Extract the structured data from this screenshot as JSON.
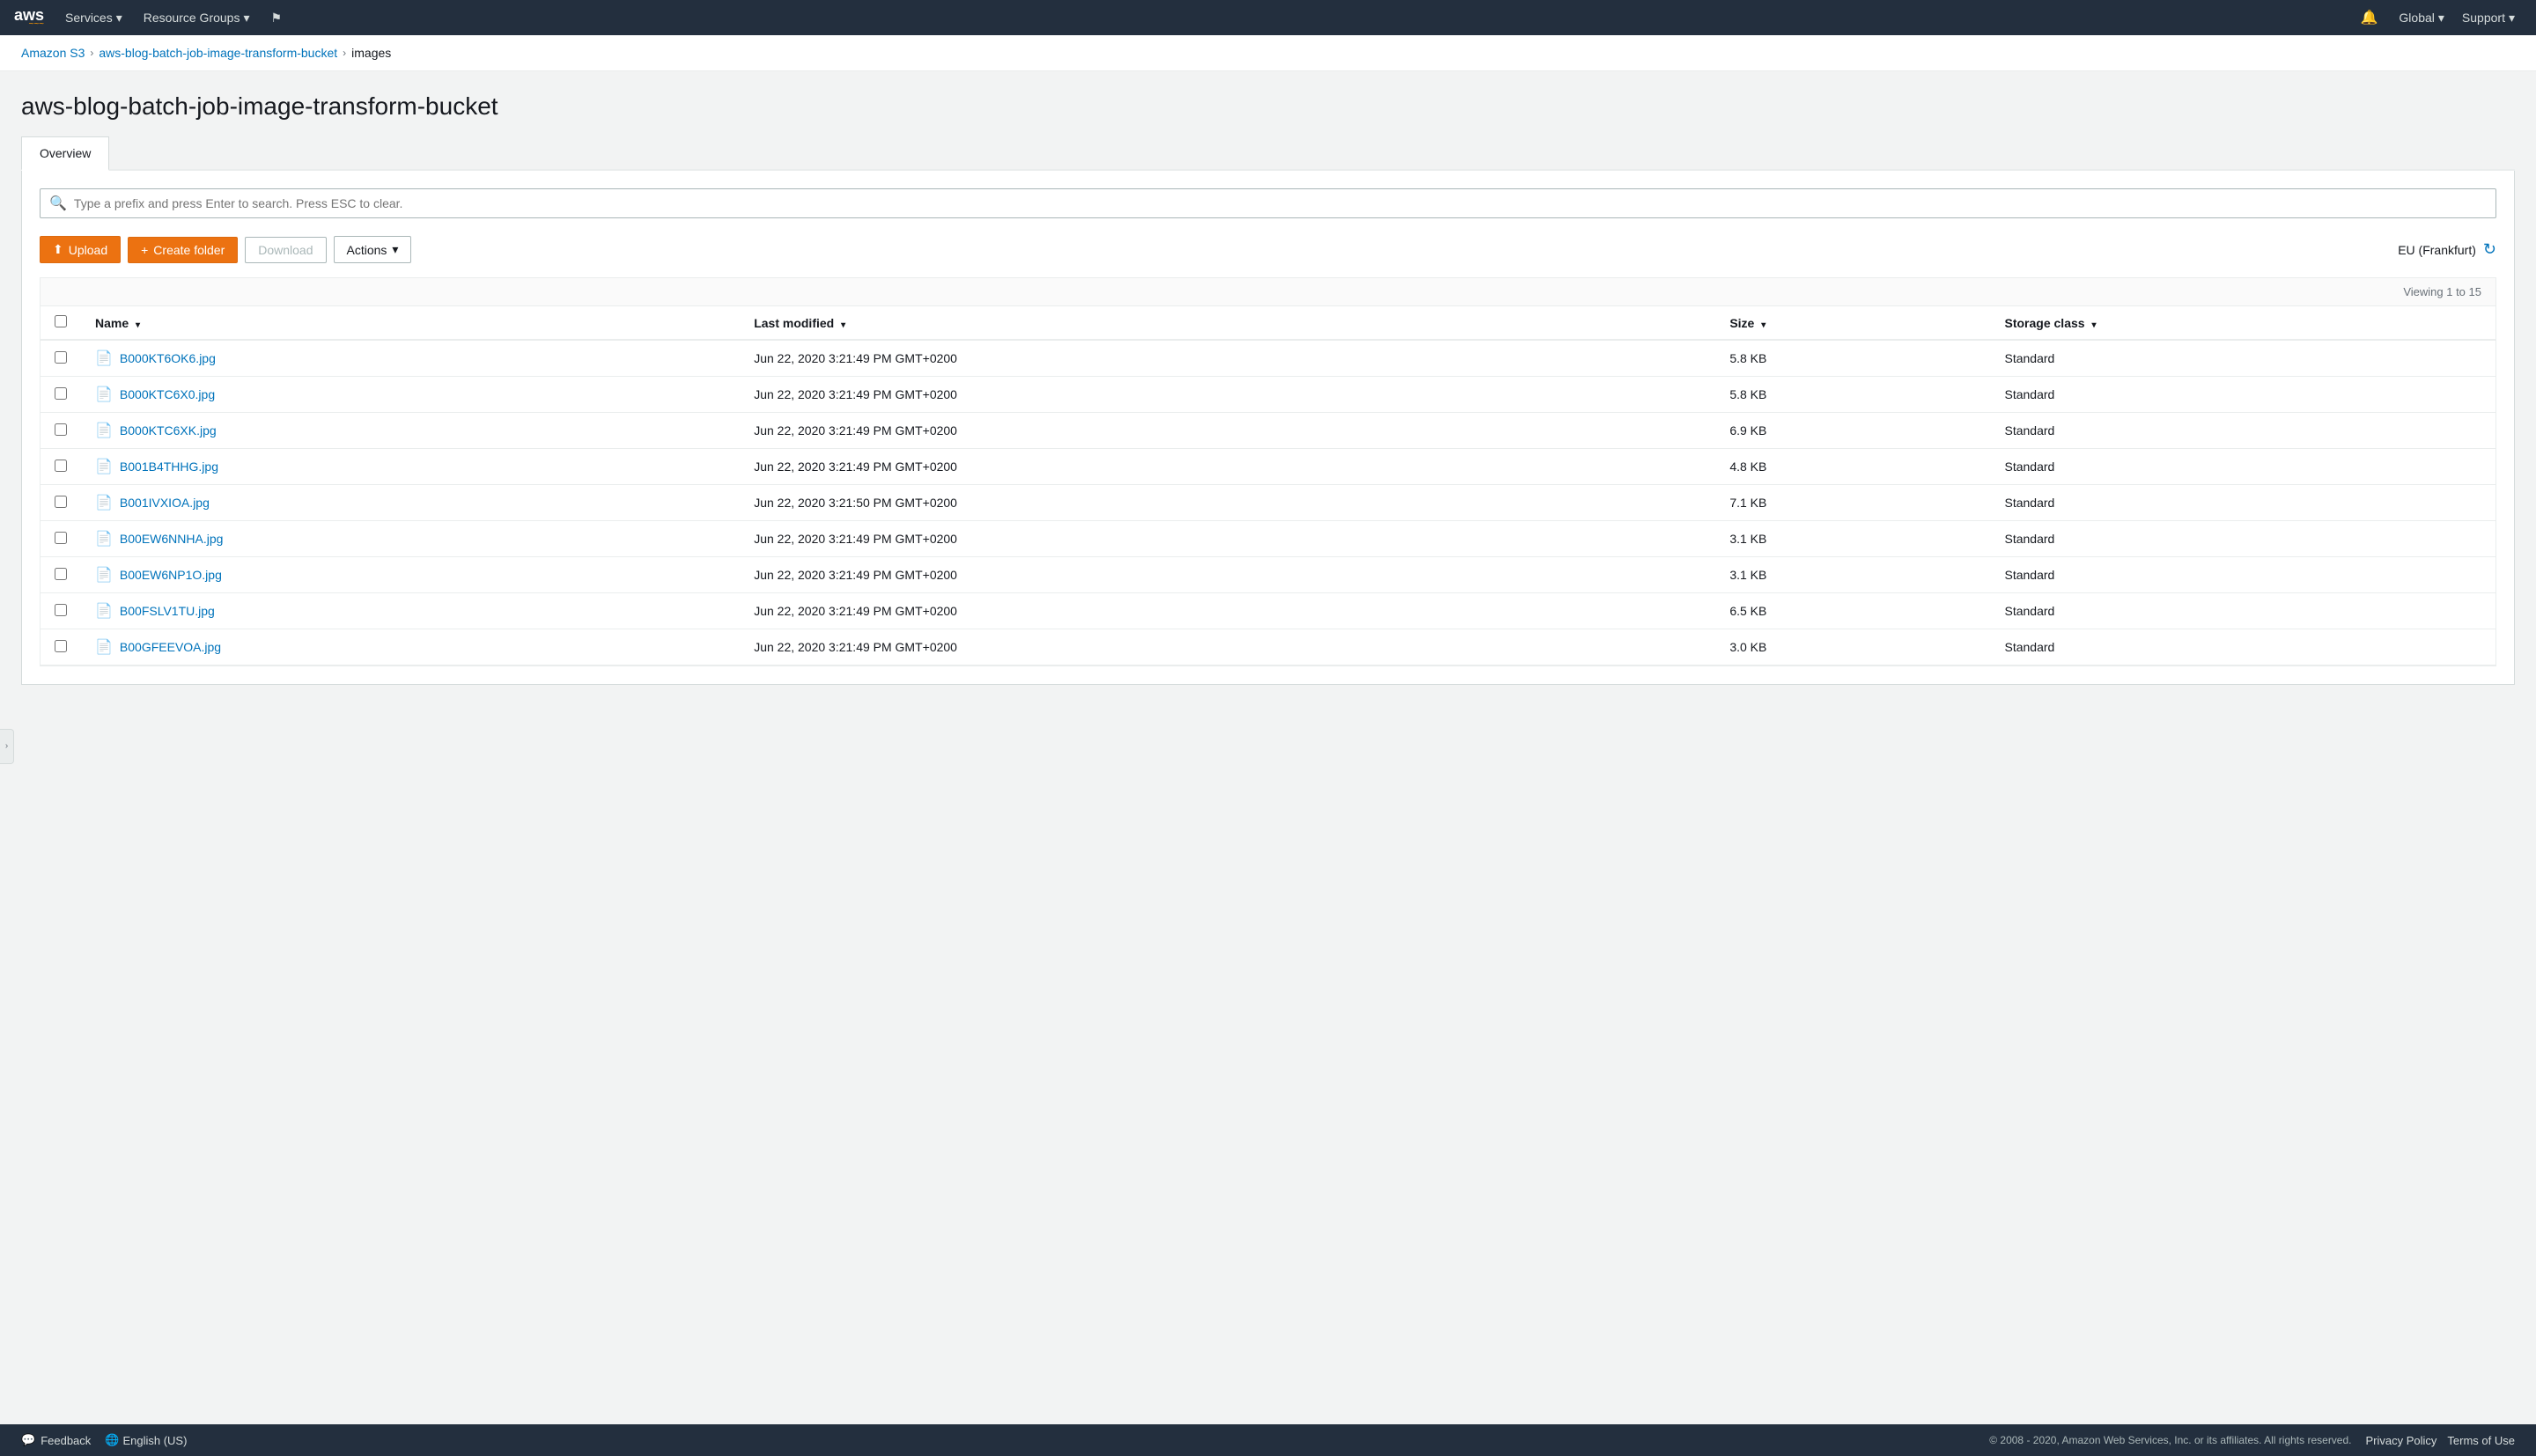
{
  "nav": {
    "logo": "aws",
    "logo_smile": "~~~",
    "services_label": "Services",
    "resource_groups_label": "Resource Groups",
    "global_label": "Global",
    "support_label": "Support"
  },
  "breadcrumb": {
    "s3_label": "Amazon S3",
    "bucket_label": "aws-blog-batch-job-image-transform-bucket",
    "folder_label": "images"
  },
  "page": {
    "title": "aws-blog-batch-job-image-transform-bucket",
    "tab_overview": "Overview",
    "search_placeholder": "Type a prefix and press Enter to search. Press ESC to clear.",
    "upload_label": "Upload",
    "create_folder_label": "Create folder",
    "download_label": "Download",
    "actions_label": "Actions",
    "region_label": "EU (Frankfurt)",
    "viewing_label": "Viewing 1 to 15"
  },
  "table": {
    "col_name": "Name",
    "col_last_modified": "Last modified",
    "col_size": "Size",
    "col_storage_class": "Storage class",
    "rows": [
      {
        "name": "B000KT6OK6.jpg",
        "last_modified": "Jun 22, 2020 3:21:49 PM GMT+0200",
        "size": "5.8 KB",
        "storage_class": "Standard"
      },
      {
        "name": "B000KTC6X0.jpg",
        "last_modified": "Jun 22, 2020 3:21:49 PM GMT+0200",
        "size": "5.8 KB",
        "storage_class": "Standard"
      },
      {
        "name": "B000KTC6XK.jpg",
        "last_modified": "Jun 22, 2020 3:21:49 PM GMT+0200",
        "size": "6.9 KB",
        "storage_class": "Standard"
      },
      {
        "name": "B001B4THHG.jpg",
        "last_modified": "Jun 22, 2020 3:21:49 PM GMT+0200",
        "size": "4.8 KB",
        "storage_class": "Standard"
      },
      {
        "name": "B001IVXIOA.jpg",
        "last_modified": "Jun 22, 2020 3:21:50 PM GMT+0200",
        "size": "7.1 KB",
        "storage_class": "Standard"
      },
      {
        "name": "B00EW6NNHA.jpg",
        "last_modified": "Jun 22, 2020 3:21:49 PM GMT+0200",
        "size": "3.1 KB",
        "storage_class": "Standard"
      },
      {
        "name": "B00EW6NP1O.jpg",
        "last_modified": "Jun 22, 2020 3:21:49 PM GMT+0200",
        "size": "3.1 KB",
        "storage_class": "Standard"
      },
      {
        "name": "B00FSLV1TU.jpg",
        "last_modified": "Jun 22, 2020 3:21:49 PM GMT+0200",
        "size": "6.5 KB",
        "storage_class": "Standard"
      },
      {
        "name": "B00GFEEVOA.jpg",
        "last_modified": "Jun 22, 2020 3:21:49 PM GMT+0200",
        "size": "3.0 KB",
        "storage_class": "Standard"
      }
    ]
  },
  "footer": {
    "feedback_label": "Feedback",
    "lang_label": "English (US)",
    "copyright": "© 2008 - 2020, Amazon Web Services, Inc. or its affiliates. All rights reserved.",
    "privacy_policy": "Privacy Policy",
    "terms_of_use": "Terms of Use"
  }
}
